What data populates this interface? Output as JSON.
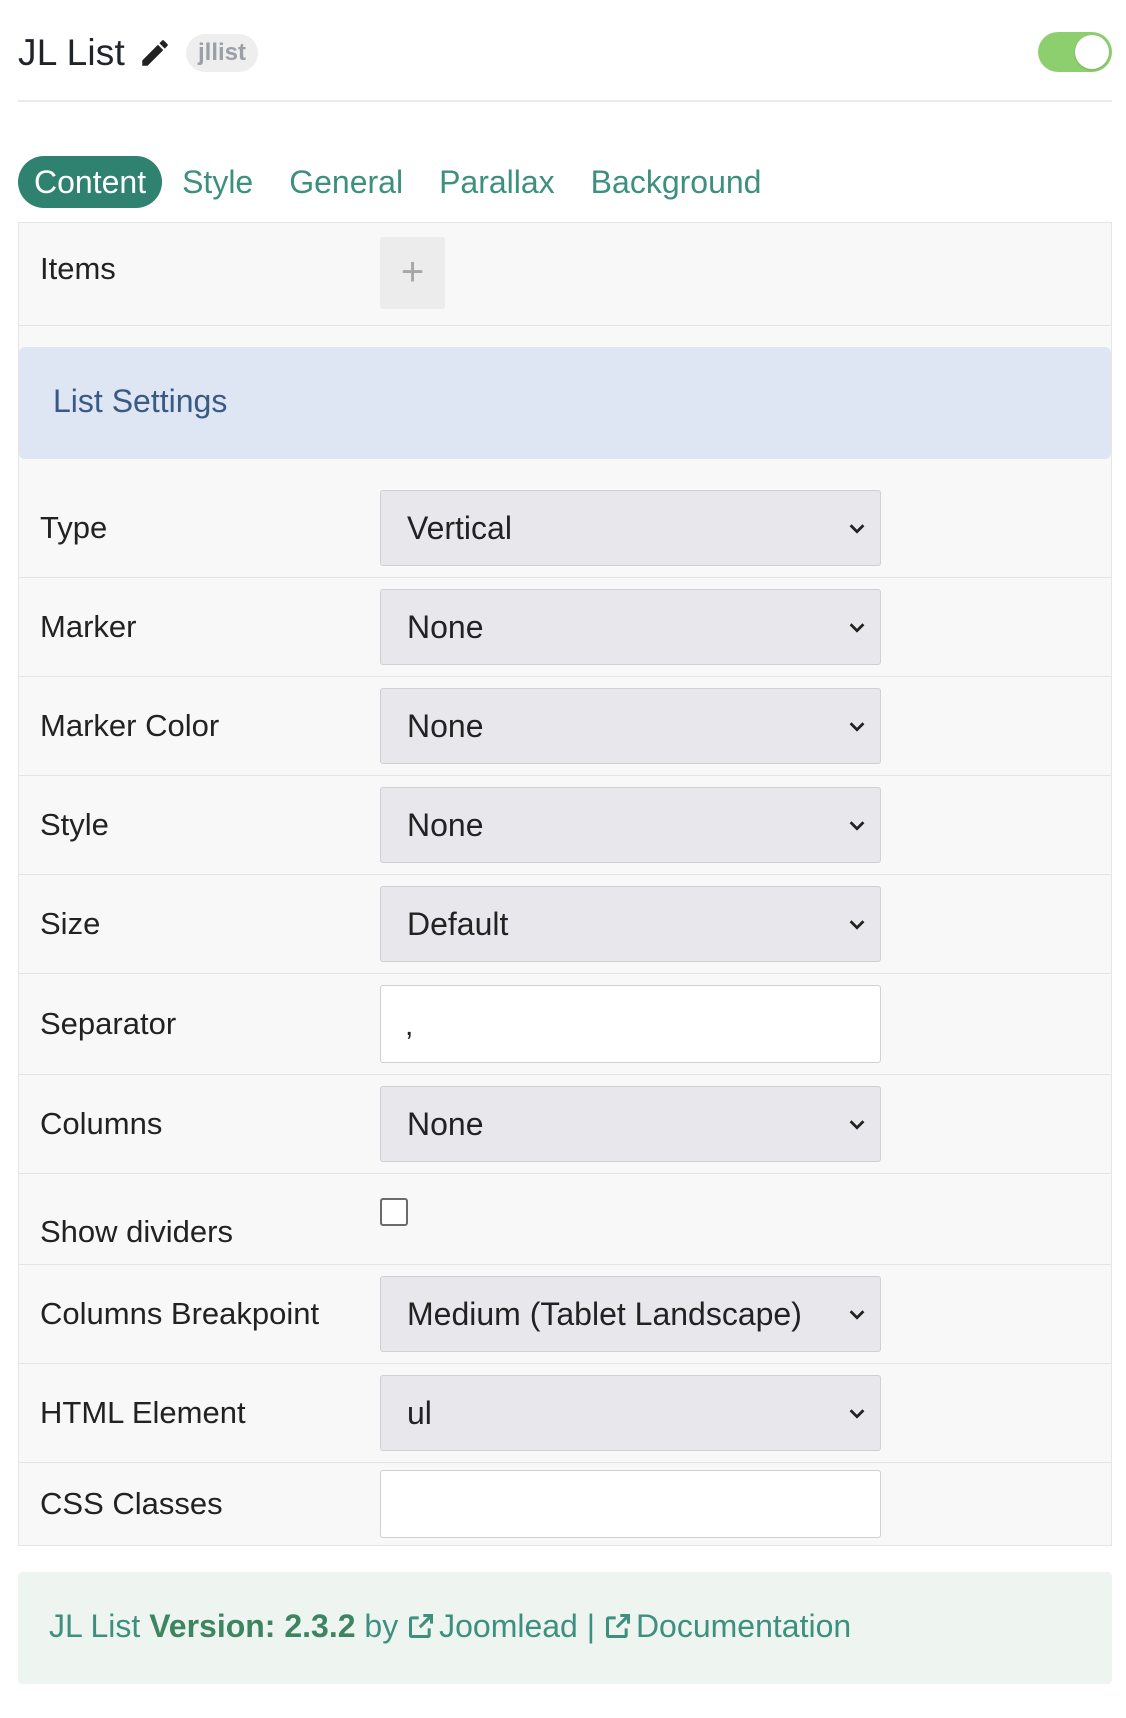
{
  "header": {
    "title": "JL List",
    "alias": "jllist",
    "enabled": true,
    "toggle_color": "#8dcf6e"
  },
  "tabs": [
    {
      "label": "Content",
      "active": true
    },
    {
      "label": "Style",
      "active": false
    },
    {
      "label": "General",
      "active": false
    },
    {
      "label": "Parallax",
      "active": false
    },
    {
      "label": "Background",
      "active": false
    }
  ],
  "items": {
    "label": "Items",
    "add_symbol": "+"
  },
  "section": {
    "title": "List Settings"
  },
  "fields": {
    "type": {
      "label": "Type",
      "value": "Vertical"
    },
    "marker": {
      "label": "Marker",
      "value": "None"
    },
    "marker_color": {
      "label": "Marker Color",
      "value": "None"
    },
    "style": {
      "label": "Style",
      "value": "None"
    },
    "size": {
      "label": "Size",
      "value": "Default"
    },
    "separator": {
      "label": "Separator",
      "value": ","
    },
    "columns": {
      "label": "Columns",
      "value": "None"
    },
    "show_dividers": {
      "label": "Show dividers",
      "checked": false
    },
    "columns_breakpoint": {
      "label": "Columns Breakpoint",
      "value": "Medium (Tablet Landscape)"
    },
    "html_element": {
      "label": "HTML Element",
      "value": "ul"
    },
    "css_classes": {
      "label": "CSS Classes",
      "value": ""
    }
  },
  "footer": {
    "name": "JL List",
    "version_label": "Version: 2.3.2",
    "by": "by",
    "author_link": "Joomlead",
    "separator": "|",
    "docs_link": "Documentation"
  },
  "colors": {
    "accent": "#2f8270",
    "link": "#3d8f7e",
    "section_bg": "#dfe6f3",
    "section_text": "#3a5a86"
  }
}
